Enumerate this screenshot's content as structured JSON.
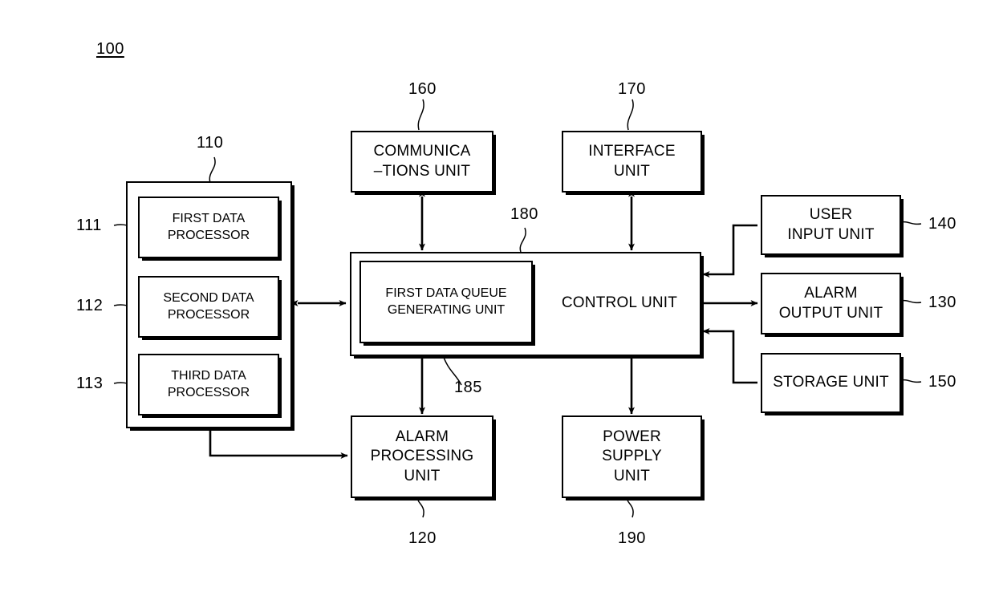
{
  "figure": {
    "system_ref": "100",
    "blocks": {
      "data_processing_group": {
        "ref": "110",
        "children": [
          {
            "ref": "111",
            "label": "FIRST DATA\nPROCESSOR"
          },
          {
            "ref": "112",
            "label": "SECOND DATA\nPROCESSOR"
          },
          {
            "ref": "113",
            "label": "THIRD DATA\nPROCESSOR"
          }
        ]
      },
      "communications_unit": {
        "ref": "160",
        "label": "COMMUNICA\n–TIONS UNIT"
      },
      "interface_unit": {
        "ref": "170",
        "label": "INTERFACE\nUNIT"
      },
      "control_unit": {
        "ref": "180",
        "label": "CONTROL UNIT",
        "queue_unit": {
          "ref": "185",
          "label": "FIRST DATA\nQUEUE\nGENERATING UNIT"
        }
      },
      "user_input_unit": {
        "ref": "140",
        "label": "USER\nINPUT UNIT"
      },
      "alarm_output_unit": {
        "ref": "130",
        "label": "ALARM\nOUTPUT UNIT"
      },
      "storage_unit": {
        "ref": "150",
        "label": "STORAGE UNIT"
      },
      "alarm_processing_unit": {
        "ref": "120",
        "label": "ALARM\nPROCESSING\nUNIT"
      },
      "power_supply_unit": {
        "ref": "190",
        "label": "POWER\nSUPPLY\nUNIT"
      }
    },
    "colors": {
      "line": "#000000",
      "background": "#ffffff"
    }
  }
}
